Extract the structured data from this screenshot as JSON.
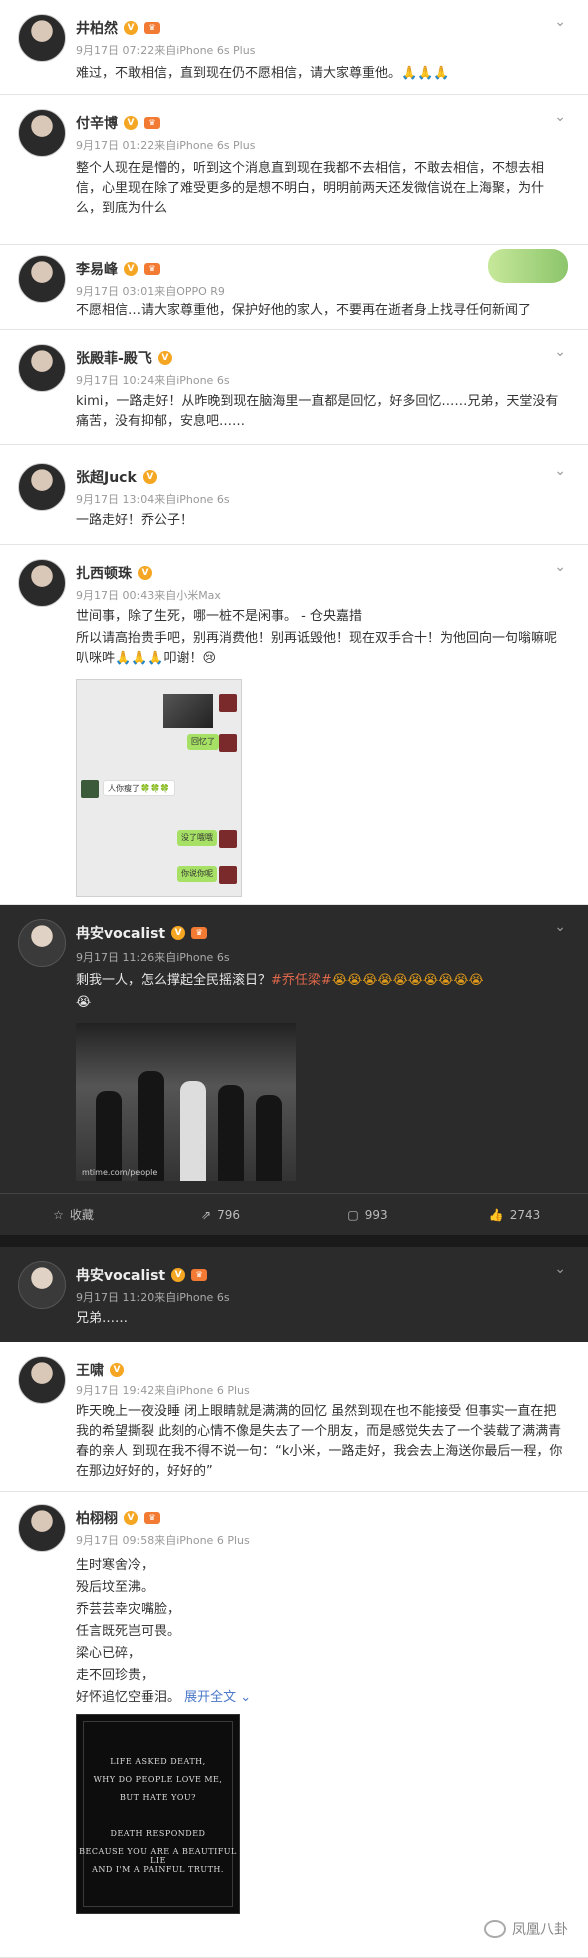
{
  "posts": [
    {
      "name": "井柏然",
      "meta": "9月17日 07:22来自iPhone 6s Plus",
      "text": "难过，不敢相信，直到现在仍不愿相信，请大家尊重他。🙏🙏🙏"
    },
    {
      "name": "付辛博",
      "meta": "9月17日 01:22来自iPhone 6s Plus",
      "text": "整个人现在是懵的，听到这个消息直到现在我都不去相信，不敢去相信，不想去相信，心里现在除了难受更多的是想不明白，明明前两天还发微信说在上海聚，为什么，到底为什么"
    },
    {
      "name": "李易峰",
      "meta": "9月17日 03:01来自OPPO R9",
      "text": "不愿相信…请大家尊重他，保护好他的家人，不要再在逝者身上找寻任何新闻了"
    },
    {
      "name": "张殿菲-殿飞",
      "meta": "9月17日 10:24来自iPhone 6s",
      "text": "kimi，一路走好！从昨晚到现在脑海里一直都是回忆，好多回忆……兄弟，天堂没有痛苦，没有抑郁，安息吧……"
    },
    {
      "name": "张超Juck",
      "meta": "9月17日 13:04来自iPhone 6s",
      "text": "一路走好！乔公子！"
    },
    {
      "name": "扎西顿珠",
      "meta": "9月17日 00:43来自小米Max",
      "text1": "世间事，除了生死，哪一桩不是闲事。 - 仓央嘉措",
      "text2": "所以请高抬贵手吧，别再消费他！别再诋毁他！现在双手合十！为他回向一句嗡嘛呢叭咪吽🙏🙏🙏叩谢！😢"
    },
    {
      "name": "冉安vocalist",
      "meta": "9月17日 11:26来自iPhone 6s",
      "text": "剩我一人，怎么撑起全民摇滚日？",
      "hashtag": "#乔任梁#",
      "emojis": "😭😭😭😭😭😭😭😭😭😭",
      "emoji_last": "😭"
    },
    {
      "name": "冉安vocalist",
      "meta": "9月17日 11:20来自iPhone 6s",
      "text": "兄弟……"
    },
    {
      "name": "王啸",
      "meta": "9月17日 19:42来自iPhone 6 Plus",
      "text": "昨天晚上一夜没睡 闭上眼睛就是满满的回忆 虽然到现在也不能接受 但事实一直在把我的希望撕裂 此刻的心情不像是失去了一个朋友，而是感觉失去了一个装载了满满青春的亲人 到现在我不得不说一句：“k小米，一路走好，我会去上海送你最后一程，你在那边好好的，好好的”"
    },
    {
      "name": "柏栩栩",
      "meta": "9月17日 09:58来自iPhone 6 Plus"
    }
  ],
  "chat": {
    "caption": "回忆了",
    "msg1": "想吃了",
    "msg2": "人你瘦了🍀🍀🍀",
    "msg3": "没了哦哦",
    "msg4": "你说你呢"
  },
  "photo_caption": "mtime.com/people",
  "actions": {
    "share": "收藏",
    "repost": "796",
    "comment": "993",
    "like": "2743"
  },
  "poem": [
    "生时寒舍冷，",
    "殁后坟至沸。",
    "乔芸芸幸灾嘴脸，",
    "任言既死岂可畏。",
    "梁心已碎，",
    "走不回珍贵，"
  ],
  "poem_last": "好怀追忆空垂泪。",
  "expand": "展开全文",
  "quote_lines": [
    "LIFE ASKED DEATH,",
    "WHY DO PEOPLE LOVE ME,",
    "BUT HATE YOU?",
    "DEATH RESPONDED",
    "BECAUSE YOU ARE A BEAUTIFUL LIE",
    "AND I'M A PAINFUL TRUTH."
  ],
  "watermark": "凤凰八卦",
  "badges": {
    "v": "V",
    "crown": "♛"
  }
}
